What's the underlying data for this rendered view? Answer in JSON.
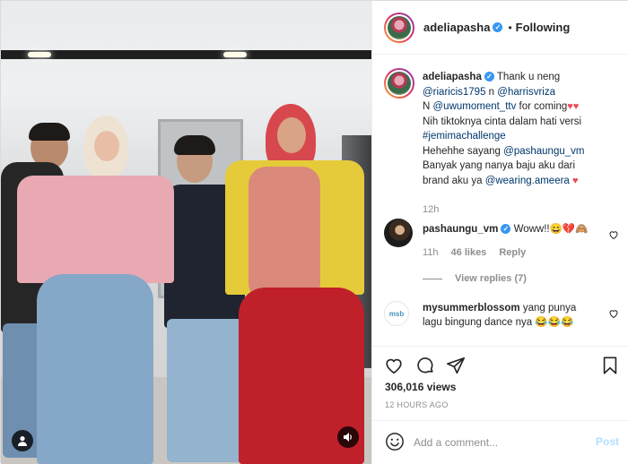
{
  "header": {
    "username": "adeliapasha",
    "separator": "•",
    "follow_status": "Following",
    "verified_glyph": "✓"
  },
  "caption": {
    "username": "adeliapasha",
    "line1_pre": "Thank u neng",
    "mention1": "@riaricis1795",
    "line2_mid": " n ",
    "mention2": "@harrisvriza",
    "mention3": "@uwumoment_ttv",
    "line3_pre": "N ",
    "line3_post": " for coming",
    "line4": "Nih tiktoknya cinta dalam hati versi",
    "hashtag": "#jemimachallenge",
    "line6_pre": "Hehehhe sayang ",
    "mention4": "@pashaungu_vm",
    "line7": "Banyak yang nanya baju aku dari",
    "line8_pre": "brand aku ya ",
    "mention5": "@wearing.ameera",
    "hearts": "♥♥",
    "heart_single": "♥",
    "time": "12h"
  },
  "comments": [
    {
      "username": "pashaungu_vm",
      "text": "Woww!!😄💔🙈",
      "time": "11h",
      "likes": "46 likes",
      "reply": "Reply",
      "view_replies": "View replies (7)"
    },
    {
      "username": "mysummerblossom",
      "text_line1": "yang punya",
      "text_line2": "lagu bingung dance nya 😂😂😂",
      "avatar_text": "msb"
    }
  ],
  "actions": {
    "views": "306,016 views",
    "ago": "12 HOURS AGO"
  },
  "add_comment": {
    "placeholder": "Add a comment...",
    "post_label": "Post"
  },
  "icons": {
    "like": "heart-icon",
    "comment": "comment-icon",
    "share": "share-icon",
    "save": "bookmark-icon",
    "emoji": "emoji-icon",
    "sound": "sound-icon",
    "user": "user-tag-icon"
  },
  "colors": {
    "link": "#00376b",
    "verified": "#3897f0",
    "heart": "#ed4956",
    "post_disabled": "#b2dffc"
  }
}
